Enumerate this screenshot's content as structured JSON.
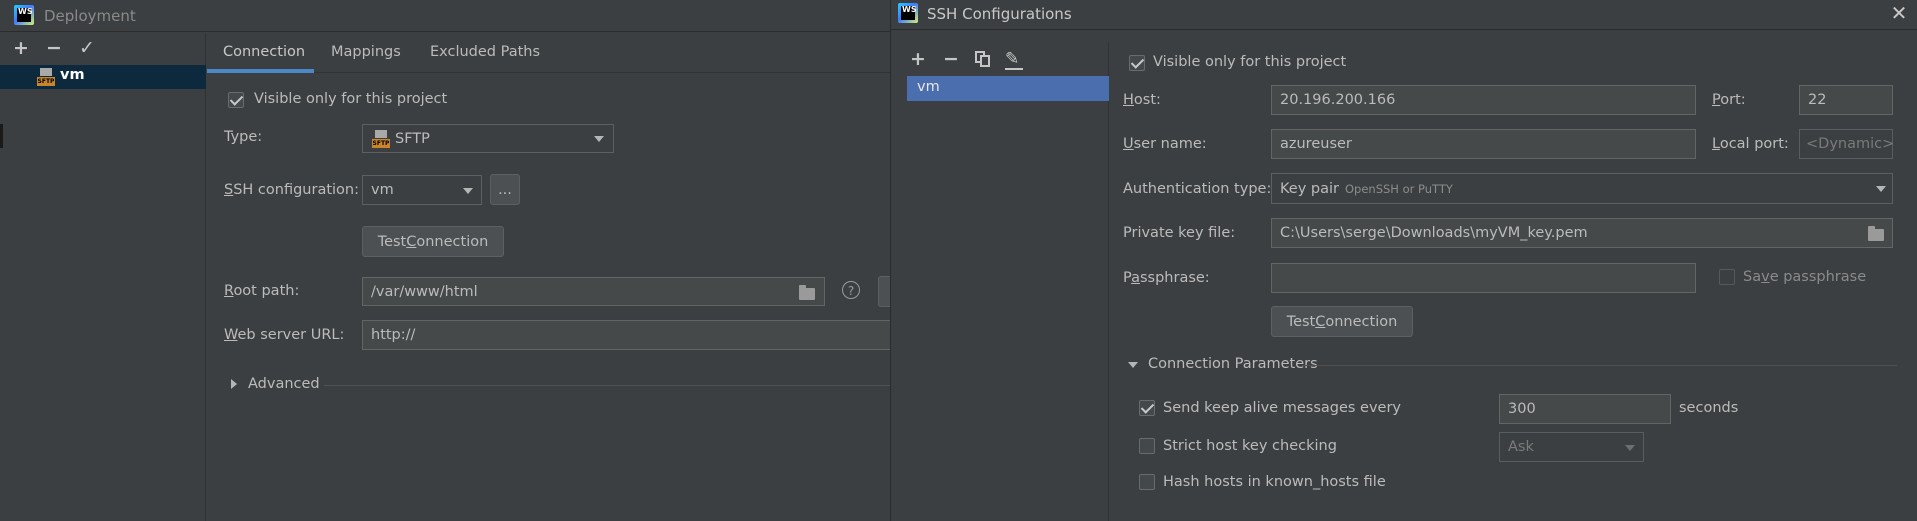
{
  "deployment": {
    "title": "Deployment",
    "server_name": "vm",
    "tabs": [
      "Connection",
      "Mappings",
      "Excluded Paths"
    ],
    "visible_only_label": "Visible only for this project",
    "type_label": "Type:",
    "type_value": "SFTP",
    "ssh_config_label": "SSH configuration:",
    "ssh_config_value": "vm",
    "ellipsis_label": "...",
    "test_connection_label": "Test Connection",
    "root_path_label": "Root path:",
    "root_path_value": "/var/www/html",
    "help_label": "?",
    "web_url_label": "Web server URL:",
    "web_url_value": "http://",
    "advanced_label": "Advanced"
  },
  "ssh": {
    "title": "SSH Configurations",
    "list_item": "vm",
    "visible_only_label": "Visible only for this project",
    "host_label": "Host:",
    "host_value": "20.196.200.166",
    "port_label": "Port:",
    "port_value": "22",
    "username_label": "User name:",
    "username_value": "azureuser",
    "local_port_label": "Local port:",
    "local_port_placeholder": "<Dynamic>",
    "auth_type_label": "Authentication type:",
    "auth_type_value": "Key pair",
    "auth_type_hint": "OpenSSH or PuTTY",
    "private_key_label": "Private key file:",
    "private_key_value": "C:\\Users\\serge\\Downloads\\myVM_key.pem",
    "passphrase_label": "Passphrase:",
    "save_passphrase_label": "Save passphrase",
    "test_connection_label": "Test Connection",
    "conn_params_label": "Connection Parameters",
    "keep_alive_label": "Send keep alive messages every",
    "keep_alive_value": "300",
    "seconds_label": "seconds",
    "strict_host_label": "Strict host key checking",
    "strict_host_value": "Ask",
    "hash_hosts_label": "Hash hosts in known_hosts file"
  },
  "colors": {
    "background": "#3c3f41",
    "selection": "#4b6eaf",
    "tree_selection": "#0d293e",
    "tab_underline": "#4a88c7"
  }
}
